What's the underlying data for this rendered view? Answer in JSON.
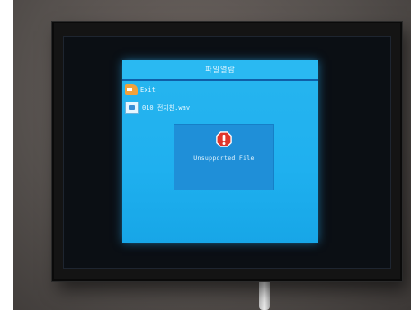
{
  "window": {
    "title": "파일열람"
  },
  "file_list": {
    "items": [
      {
        "label": "Exit",
        "icon": "back-arrow-icon"
      },
      {
        "label": "010 전지찬.wav",
        "icon": "file-icon"
      }
    ]
  },
  "dialog": {
    "message": "Unsupported File",
    "icon": "stop-icon"
  },
  "colors": {
    "screen": "#1fb0ef",
    "titlebar_rule": "#0f5fa8",
    "dialog": "#1f8fd8",
    "stop": "#e0362c"
  }
}
